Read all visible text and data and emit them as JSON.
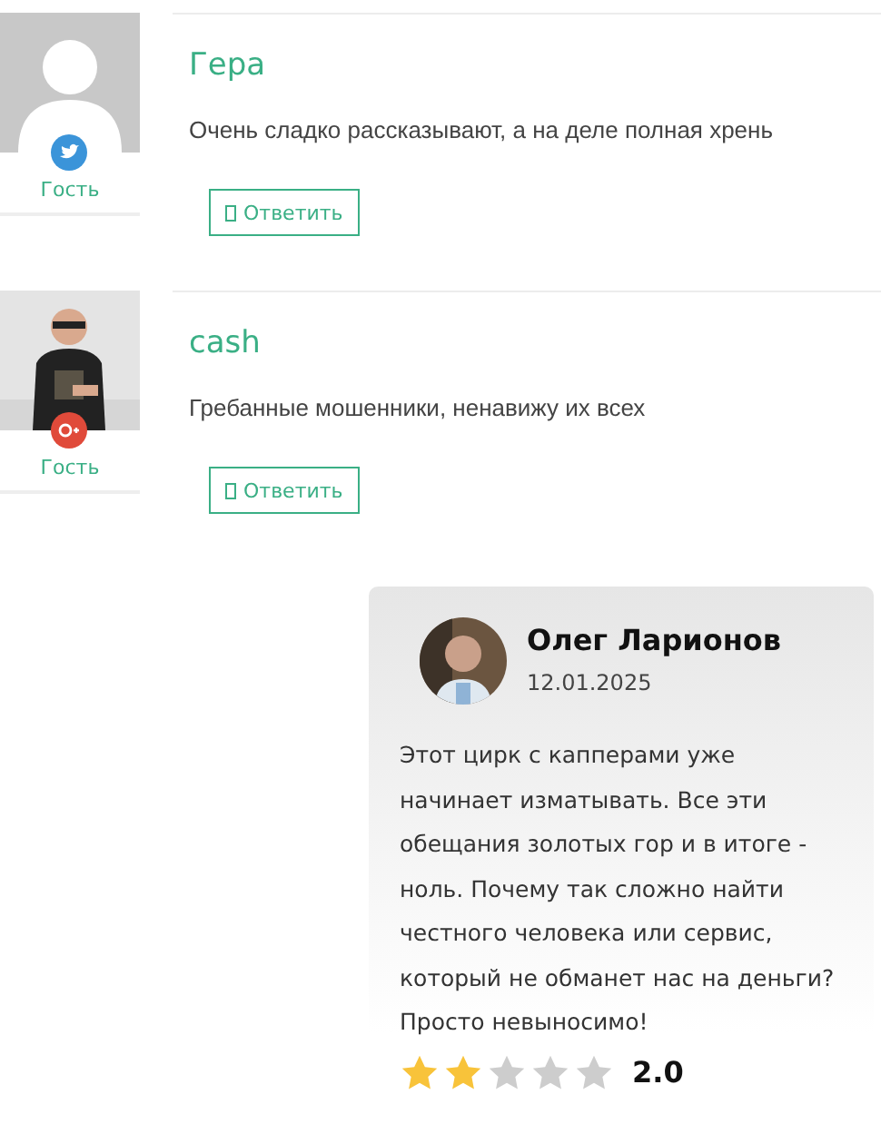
{
  "comments": [
    {
      "name": "Гера",
      "text": "Очень сладко рассказывают, а на деле полная хрень",
      "avatar": {
        "kind": "placeholder"
      },
      "badge": {
        "kind": "twitter"
      },
      "role": "Гость",
      "reply": "Ответить"
    },
    {
      "name": "cash",
      "text": "Гребанные мошенники, ненавижу их всех",
      "badge": {
        "kind": "gplus"
      },
      "role": "Гость",
      "reply": "Ответить"
    }
  ],
  "review": {
    "name": "Олег Ларионов",
    "date": "12.01.2025",
    "text": "Этот цирк с капперами уже начинает изматывать. Все эти обещания золотых гор и в итоге - ноль. Почему так сложно найти честного человека или сервис, который не обманет нас на деньги? Просто невыносимо!",
    "stars": 2,
    "rating": "2.0"
  }
}
